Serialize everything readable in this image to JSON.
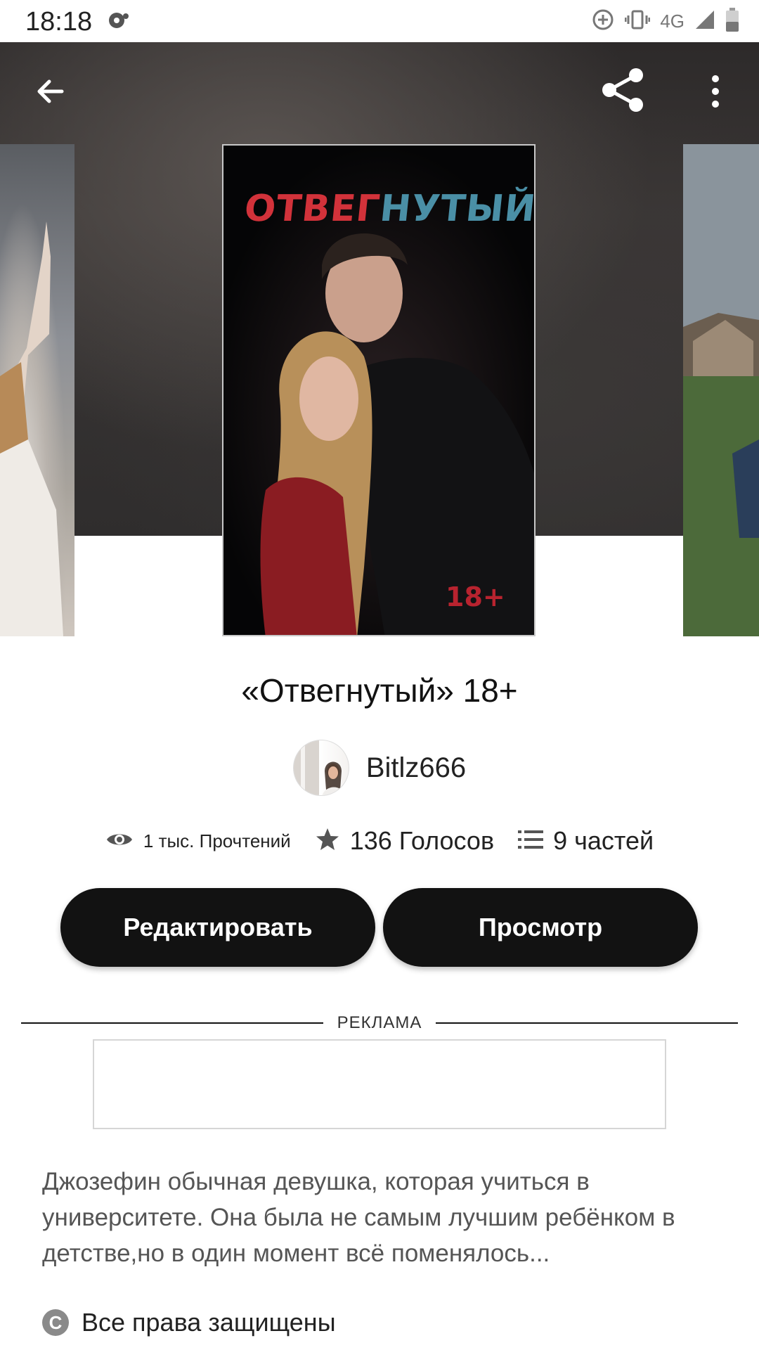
{
  "status_bar": {
    "time": "18:18",
    "network": "4G",
    "icons": [
      "cast-icon",
      "data-saver-icon",
      "vibrate-icon",
      "signal-icon",
      "battery-icon"
    ]
  },
  "toolbar": {
    "back_icon": "arrow-left-icon",
    "share_icon": "share-icon",
    "more_icon": "more-vertical-icon"
  },
  "cover": {
    "title_part1": "ОТВЕГ",
    "title_part2": "НУТЫЙ",
    "age_mark": "18+"
  },
  "story": {
    "title": "«Отвегнутый» 18+",
    "author": "Bitlz666",
    "reads": "1 тыс. Прочтений",
    "votes": "136 Голосов",
    "parts": "9 частей"
  },
  "actions": {
    "edit_label": "Редактировать",
    "view_label": "Просмотр"
  },
  "ad": {
    "label": "РЕКЛАМА"
  },
  "description": "Джозефин обычная девушка, которая учиться в университете. Она была не самым лучшим ребёнком в детстве,но в один момент всё поменялось...",
  "copyright": "Все права защищены",
  "colors": {
    "button_bg": "#121212",
    "cover_red": "#d2323a",
    "cover_blue": "#4a8fa6"
  }
}
